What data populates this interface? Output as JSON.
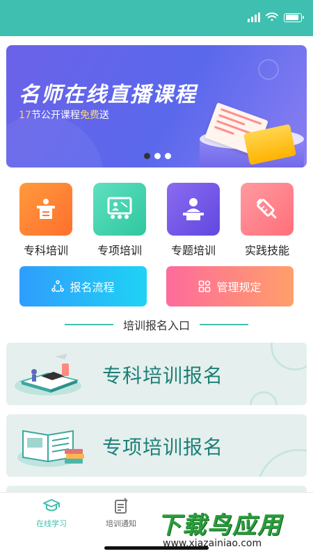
{
  "status": {
    "battery_level": 0.9,
    "signal_bars": 4
  },
  "banner": {
    "title": "名师在线直播课程",
    "subtitle_num": "17",
    "subtitle_mid": "节公开课程",
    "subtitle_hl": "免费",
    "subtitle_end": "送",
    "slides": 3,
    "active_slide": 0,
    "colors": {
      "bg_start": "#6b62e8",
      "bg_end": "#8a7ff2",
      "highlight": "#ffd86b"
    }
  },
  "quick_links": [
    {
      "label": "专科培训",
      "icon": "lectern-icon",
      "color_start": "#ff9a3c",
      "color_end": "#ff6f2e"
    },
    {
      "label": "专项培训",
      "icon": "classroom-icon",
      "color_start": "#5fe0c0",
      "color_end": "#2fc79f"
    },
    {
      "label": "专题培训",
      "icon": "speaker-icon",
      "color_start": "#8a6cf0",
      "color_end": "#6247e0"
    },
    {
      "label": "实践技能",
      "icon": "syringe-icon",
      "color_start": "#ff9aa0",
      "color_end": "#ff6f7a"
    }
  ],
  "actions": {
    "process": {
      "label": "报名流程",
      "icon": "process-icon",
      "color_start": "#2f9dfc",
      "color_end": "#1fd3f5"
    },
    "rules": {
      "label": "管理规定",
      "icon": "grid-icon",
      "color_start": "#fd6b9b",
      "color_end": "#ff9f6b"
    }
  },
  "section": {
    "title": "培训报名入口",
    "accent": "#3fbfb0"
  },
  "cards": [
    {
      "label": "专科培训报名",
      "icon": "graduation-books-icon"
    },
    {
      "label": "专项培训报名",
      "icon": "open-book-icon"
    }
  ],
  "tabs": [
    {
      "label": "在线学习",
      "icon": "graduation-cap-icon",
      "active": true
    },
    {
      "label": "培训通知",
      "icon": "notice-icon",
      "active": false
    }
  ],
  "watermark": {
    "main": "下载鸟应用",
    "url": "www.xiazainiao.com"
  }
}
